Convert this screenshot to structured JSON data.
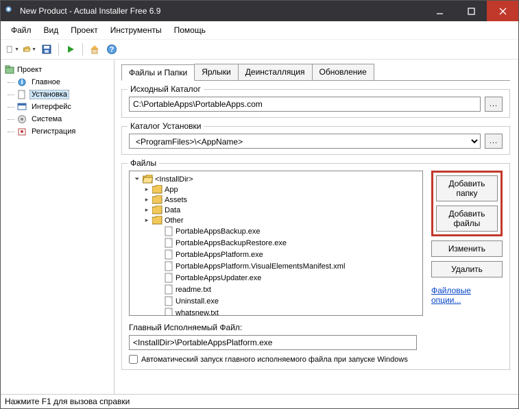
{
  "window": {
    "title": "New Product - Actual Installer Free 6.9"
  },
  "menu": {
    "file": "Файл",
    "view": "Вид",
    "project": "Проект",
    "tools": "Инструменты",
    "help": "Помощь"
  },
  "sidebar": {
    "root": "Проект",
    "items": [
      {
        "label": "Главное"
      },
      {
        "label": "Установка"
      },
      {
        "label": "Интерфейс"
      },
      {
        "label": "Система"
      },
      {
        "label": "Регистрация"
      }
    ]
  },
  "tabs": {
    "files": "Файлы и Папки",
    "shortcuts": "Ярлыки",
    "uninstall": "Деинсталляция",
    "update": "Обновление"
  },
  "source": {
    "legend": "Исходный Каталог",
    "value": "C:\\PortableApps\\PortableApps.com"
  },
  "install": {
    "legend": "Каталог Установки",
    "value": "<ProgramFiles>\\<AppName>"
  },
  "files": {
    "legend": "Файлы",
    "root": "<InstallDir>",
    "folders": [
      "App",
      "Assets",
      "Data",
      "Other"
    ],
    "leafs": [
      "PortableAppsBackup.exe",
      "PortableAppsBackupRestore.exe",
      "PortableAppsPlatform.exe",
      "PortableAppsPlatform.VisualElementsManifest.xml",
      "PortableAppsUpdater.exe",
      "readme.txt",
      "Uninstall.exe",
      "whatsnew.txt"
    ],
    "buttons": {
      "addFolder": "Добавить папку",
      "addFiles": "Добавить файлы",
      "edit": "Изменить",
      "delete": "Удалить"
    },
    "optionsLink": "Файловые опции..."
  },
  "mainExe": {
    "label": "Главный Исполняемый Файл:",
    "value": "<InstallDir>\\PortableAppsPlatform.exe",
    "autorun": "Автоматический запуск главного исполняемого файла при запуске Windows"
  },
  "status": "Нажмите F1 для вызова справки"
}
